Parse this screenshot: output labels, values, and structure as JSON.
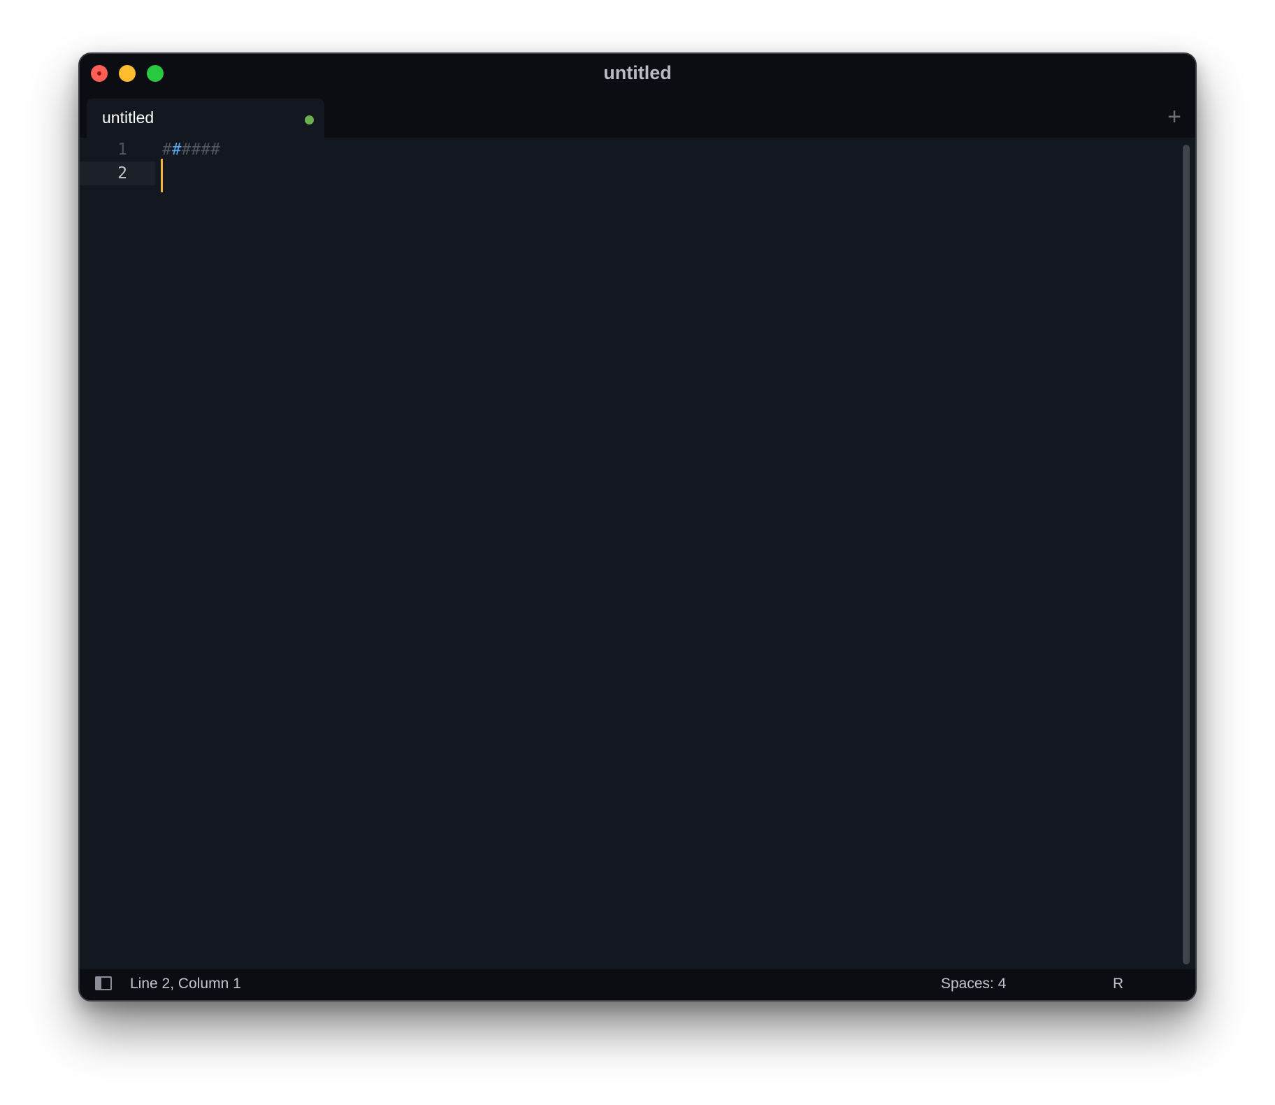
{
  "window": {
    "title": "untitled"
  },
  "tabs": [
    {
      "label": "untitled",
      "dirty": true
    }
  ],
  "tabbar": {
    "new_tab_symbol": "+"
  },
  "editor": {
    "lines": [
      {
        "number": "1",
        "text_dim_a": "#",
        "text_blue": "#",
        "text_dim_b": "####"
      },
      {
        "number": "2",
        "text": ""
      }
    ],
    "current_line": 2
  },
  "statusbar": {
    "position": "Line 2, Column 1",
    "indentation": "Spaces: 4",
    "syntax": "R"
  },
  "colors": {
    "background": "#121720",
    "chrome": "#0b0d12",
    "caret": "#f0b23a",
    "dirty_dot": "#6ab04c",
    "heading_hash": "#5aa7ee",
    "close": "#ff5f57",
    "minimize": "#febc2e",
    "maximize": "#28c840"
  }
}
